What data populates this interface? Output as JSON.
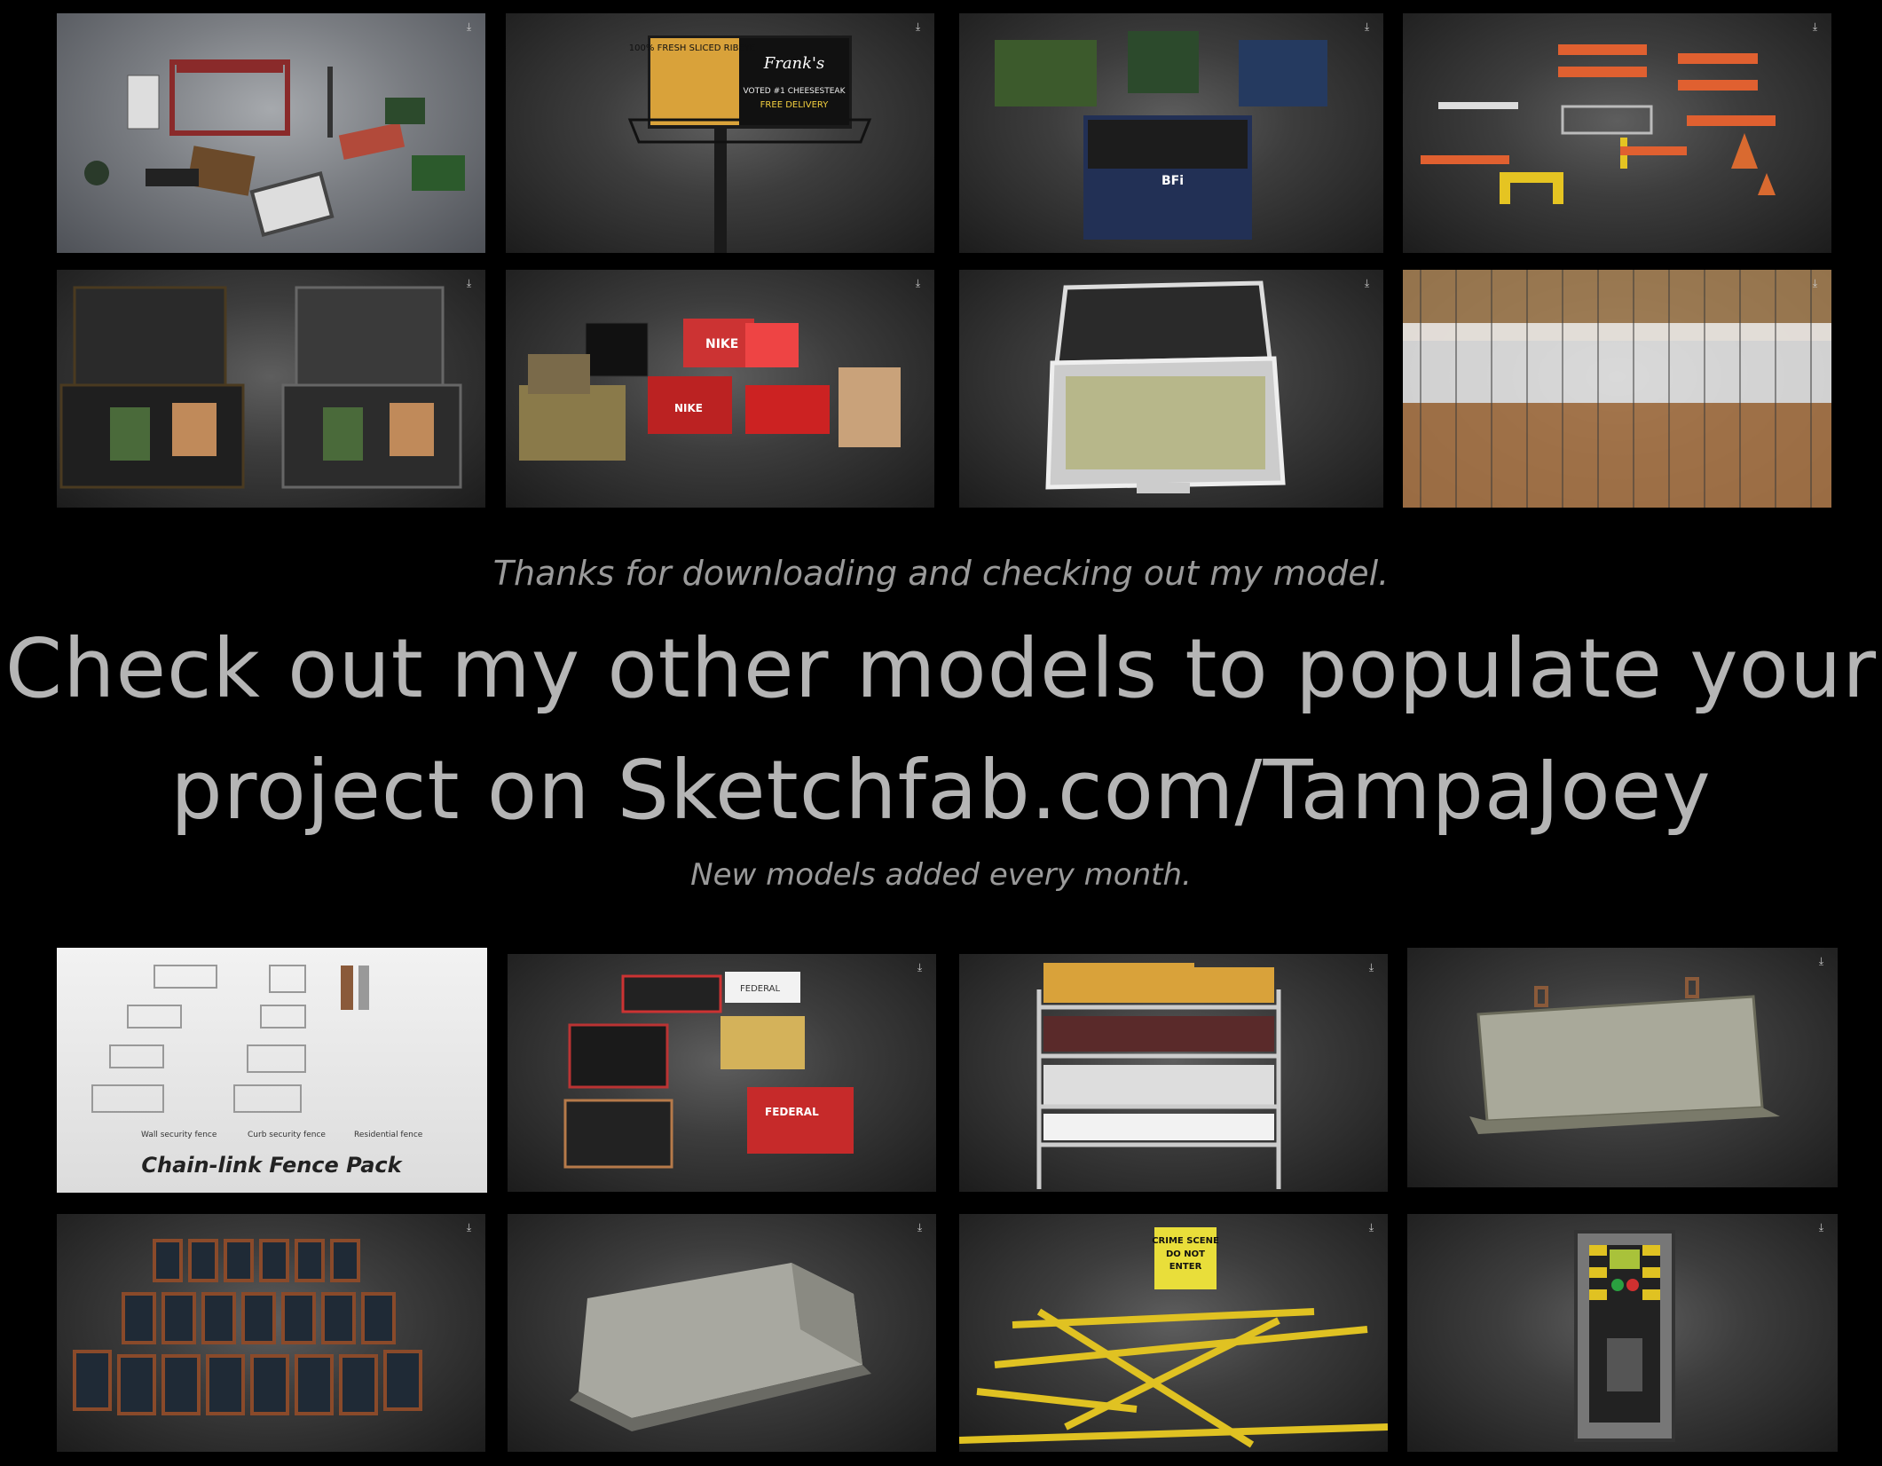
{
  "messages": {
    "thanks": "Thanks for downloading and checking out my model.",
    "headline_line1": "Check out my other models to populate your",
    "headline_line2": "project on Sketchfab.com/TampaJoey",
    "new_models": "New models added every month."
  },
  "thumbnails_top": [
    {
      "name": "street-props"
    },
    {
      "name": "billboard",
      "text": [
        "100% FRESH SLICED RIBEYE",
        "Frank's",
        "VOTED #1 CHEESESTEAK",
        "FREE DELIVERY"
      ]
    },
    {
      "name": "dumpsters",
      "text": [
        "BFi"
      ]
    },
    {
      "name": "road-barricades"
    },
    {
      "name": "briefcase-electronics"
    },
    {
      "name": "shoebox-cash",
      "text": [
        "NIKE",
        "NIKE"
      ]
    },
    {
      "name": "briefcase-cash"
    },
    {
      "name": "picket-fences"
    }
  ],
  "thumbnails_bottom": [
    {
      "name": "chain-link-fence-pack",
      "text": [
        "Wall security fence",
        "Curb security fence",
        "Residential fence",
        "Chain-link Fence Pack"
      ]
    },
    {
      "name": "ammo-boxes",
      "text": [
        "FEDERAL",
        "FEDERAL"
      ]
    },
    {
      "name": "ammo-shelf"
    },
    {
      "name": "concrete-barrier-1"
    },
    {
      "name": "chalkboard-signs"
    },
    {
      "name": "jersey-barrier"
    },
    {
      "name": "crime-scene-tape",
      "text": [
        "CRIME SCENE",
        "DO NOT",
        "ENTER"
      ]
    },
    {
      "name": "keypad-panel"
    }
  ],
  "icons": {
    "download": "download-icon"
  }
}
